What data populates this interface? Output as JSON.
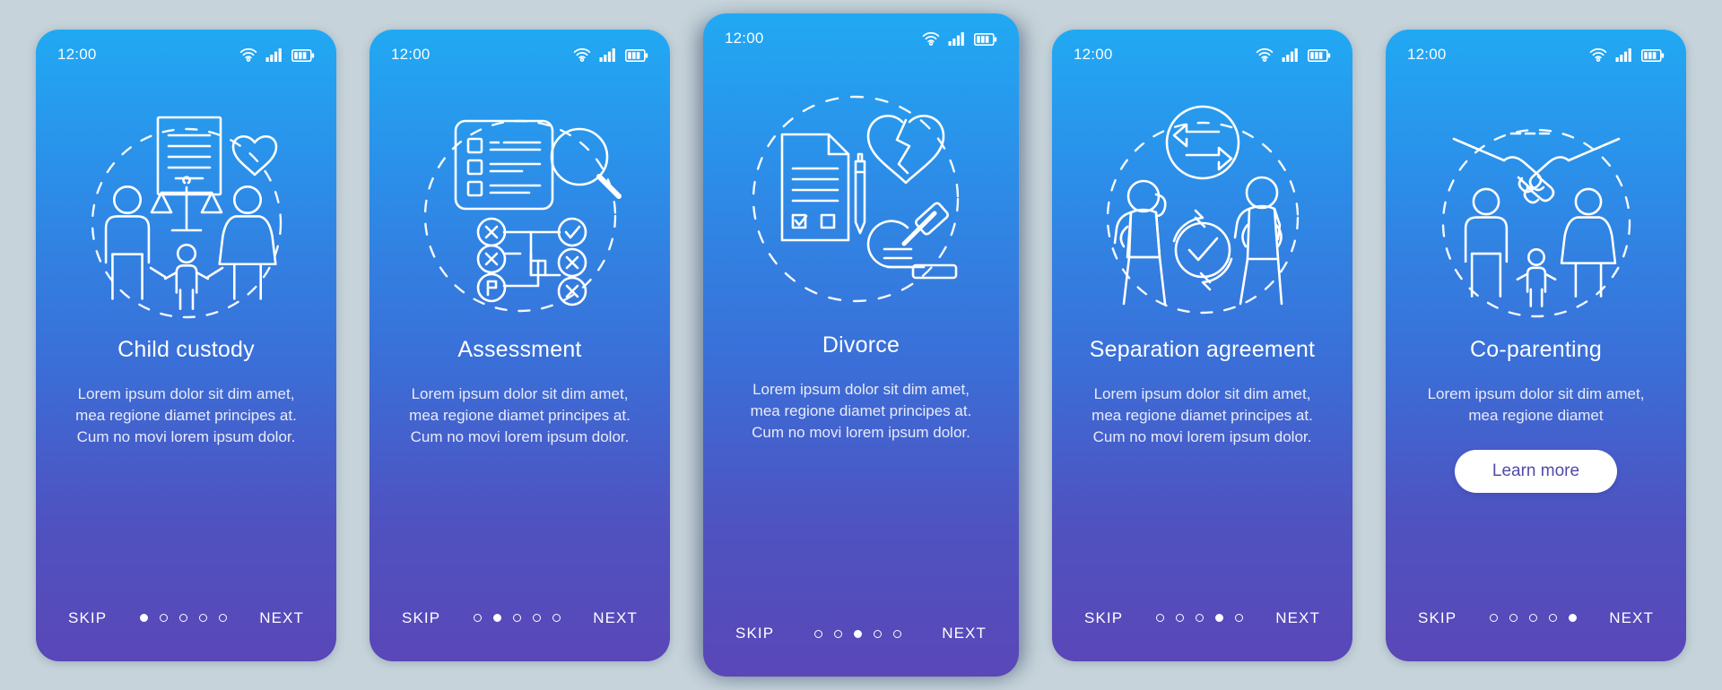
{
  "theme": {
    "page_background": "#c6d3da",
    "gradient_top": "#21a9f3",
    "gradient_bottom": "#5a47b8",
    "text_color": "#ffffff",
    "button_text_color": "#514aa8",
    "button_background": "#ffffff"
  },
  "status_bar": {
    "time": "12:00",
    "icons": [
      "wifi-icon",
      "cellular-signal-icon",
      "battery-icon"
    ]
  },
  "nav_labels": {
    "skip": "SKIP",
    "next": "NEXT"
  },
  "screens": [
    {
      "id": "child-custody",
      "title": "Child custody",
      "body": "Lorem ipsum dolor sit dim amet, mea regione diamet principes at. Cum no movi lorem ipsum dolor.",
      "illustration": "child-custody-illustration",
      "illustration_parts": [
        "document-icon",
        "heart-icon",
        "scales-of-justice-icon",
        "family-figures-icon",
        "dashed-circle"
      ],
      "active_dot": 0,
      "total_dots": 5,
      "featured": false,
      "has_learn_more": false,
      "learn_more": ""
    },
    {
      "id": "assessment",
      "title": "Assessment",
      "body": "Lorem ipsum dolor sit dim amet, mea regione diamet principes at. Cum no movi lorem ipsum dolor.",
      "illustration": "assessment-illustration",
      "illustration_parts": [
        "checklist-form-icon",
        "magnifier-icon",
        "decision-tree-icon",
        "x-mark-icon",
        "check-mark-icon",
        "flag-icon",
        "dashed-circle"
      ],
      "active_dot": 1,
      "total_dots": 5,
      "featured": false,
      "has_learn_more": false,
      "learn_more": ""
    },
    {
      "id": "divorce",
      "title": "Divorce",
      "body": "Lorem ipsum dolor sit dim amet, mea regione diamet principes at. Cum no movi lorem ipsum dolor.",
      "illustration": "divorce-illustration",
      "illustration_parts": [
        "contract-document-icon",
        "pen-icon",
        "broken-heart-icon",
        "gavel-in-hand-icon",
        "sound-block-icon",
        "dashed-circle"
      ],
      "active_dot": 2,
      "total_dots": 5,
      "featured": true,
      "has_learn_more": false,
      "learn_more": ""
    },
    {
      "id": "separation-agreement",
      "title": "Separation agreement",
      "body": "Lorem ipsum dolor sit dim amet, mea regione diamet principes at. Cum no movi lorem ipsum dolor.",
      "illustration": "separation-agreement-illustration",
      "illustration_parts": [
        "exchange-arrows-icon",
        "woman-walking-icon",
        "man-walking-icon",
        "refresh-check-icon",
        "dashed-circle"
      ],
      "active_dot": 3,
      "total_dots": 5,
      "featured": false,
      "has_learn_more": false,
      "learn_more": ""
    },
    {
      "id": "co-parenting",
      "title": "Co-parenting",
      "body": "Lorem ipsum dolor sit dim amet, mea regione diamet",
      "illustration": "co-parenting-illustration",
      "illustration_parts": [
        "handshake-icon",
        "father-figure-icon",
        "child-figure-icon",
        "mother-figure-icon",
        "dashed-circle"
      ],
      "active_dot": 4,
      "total_dots": 5,
      "featured": false,
      "has_learn_more": true,
      "learn_more": "Learn more"
    }
  ]
}
